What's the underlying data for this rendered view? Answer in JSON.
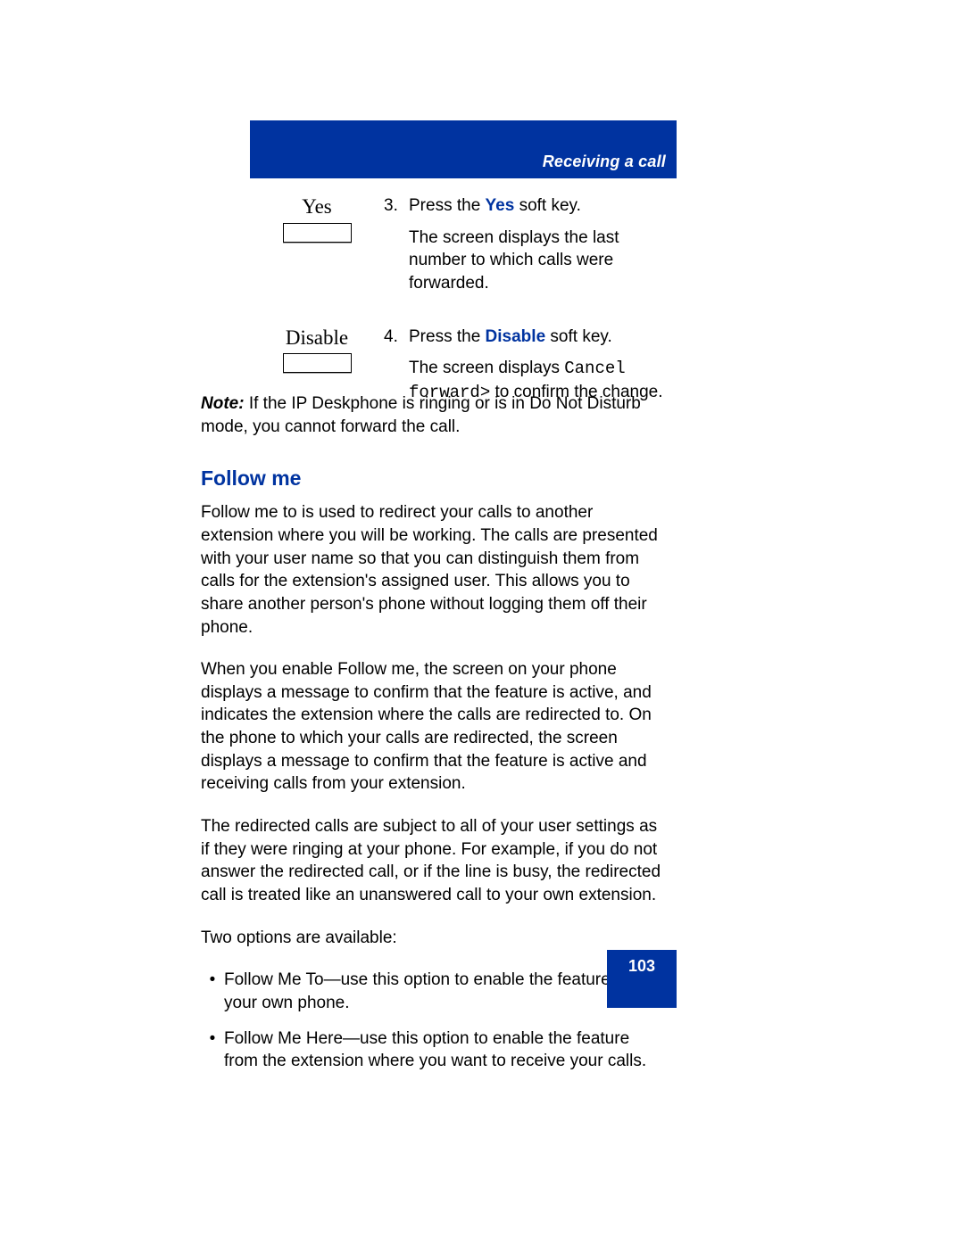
{
  "header": {
    "title": "Receiving a call"
  },
  "steps": [
    {
      "key_label": "Yes",
      "number": "3.",
      "line_pre": "Press the ",
      "bold": "Yes",
      "line_post": " soft key.",
      "sub": "The screen displays the last number to which calls were forwarded."
    },
    {
      "key_label": "Disable",
      "number": "4.",
      "line_pre": "Press the ",
      "bold": "Disable",
      "line_post": " soft key.",
      "sub_pre": "The screen displays ",
      "mono": "Cancel forward>",
      "sub_post": " to confirm the change."
    }
  ],
  "note": {
    "label": "Note:",
    "text": " If the IP Deskphone is ringing or is in Do Not Disturb mode, you cannot forward the call."
  },
  "section_title": "Follow me",
  "paragraphs": [
    "Follow me to is used to redirect your calls to another extension where you will be working. The calls are presented with your user name so that you can distinguish them from calls for the extension's assigned user. This allows you to share another person's phone without logging them off their phone.",
    "When you enable Follow me, the screen on your phone displays a message to confirm that the feature is active, and indicates the extension where the calls are redirected to. On the phone to which your calls are redirected, the screen displays a message to confirm that the feature is active and receiving calls from your extension.",
    "The redirected calls are subject to all of your user settings as if they were ringing at your phone. For example, if you do not answer the redirected call, or if the line is busy, the redirected call is treated like an unanswered call to your own extension.",
    "Two options are available:"
  ],
  "bullets": [
    "Follow Me To—use this option to enable the feature from your own phone.",
    "Follow Me Here—use this option to enable the feature from the extension where you want to receive your calls."
  ],
  "page_number": "103"
}
